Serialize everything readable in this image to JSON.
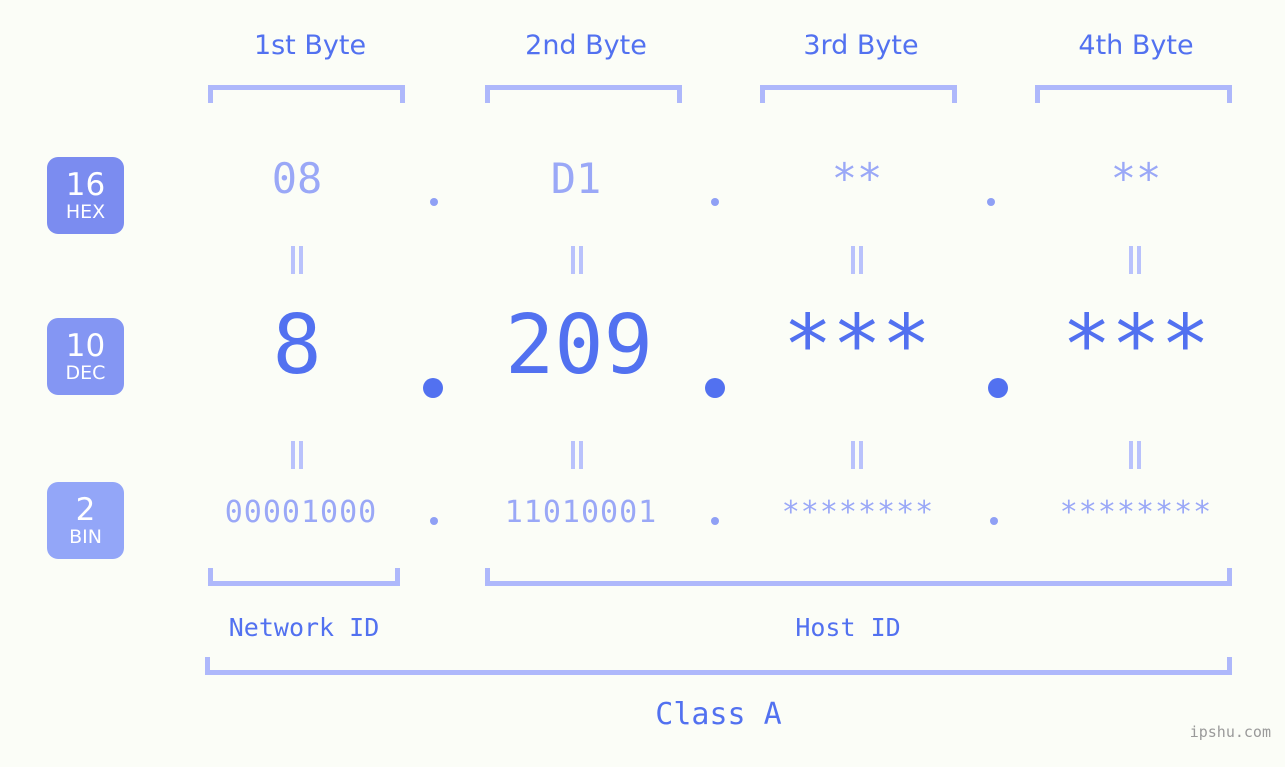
{
  "page": {
    "background_color": "#fbfdf7",
    "accent_color": "#5271f0",
    "muted_accent_color": "#9aa8f7",
    "bracket_color": "#aeb8fb"
  },
  "byte_headers": [
    {
      "label": "1st Byte"
    },
    {
      "label": "2nd Byte"
    },
    {
      "label": "3rd Byte"
    },
    {
      "label": "4th Byte"
    }
  ],
  "rows": [
    {
      "badge_number": "16",
      "badge_label": "HEX",
      "badge_color": "#7b8cf0",
      "values": [
        "08",
        "D1",
        "**",
        "**"
      ],
      "separator": "."
    },
    {
      "badge_number": "10",
      "badge_label": "DEC",
      "badge_color": "#8496f3",
      "values": [
        "8",
        "209",
        "***",
        "***"
      ],
      "separator": "."
    },
    {
      "badge_number": "2",
      "badge_label": "BIN",
      "badge_color": "#93a6f8",
      "values": [
        "00001000",
        "11010001",
        "********",
        "********"
      ],
      "separator": "."
    }
  ],
  "equivalence_marker": "=",
  "sections": [
    {
      "label": "Network ID"
    },
    {
      "label": "Host ID"
    }
  ],
  "class": {
    "label": "Class A"
  },
  "watermark": {
    "text": "ipshu.com"
  }
}
